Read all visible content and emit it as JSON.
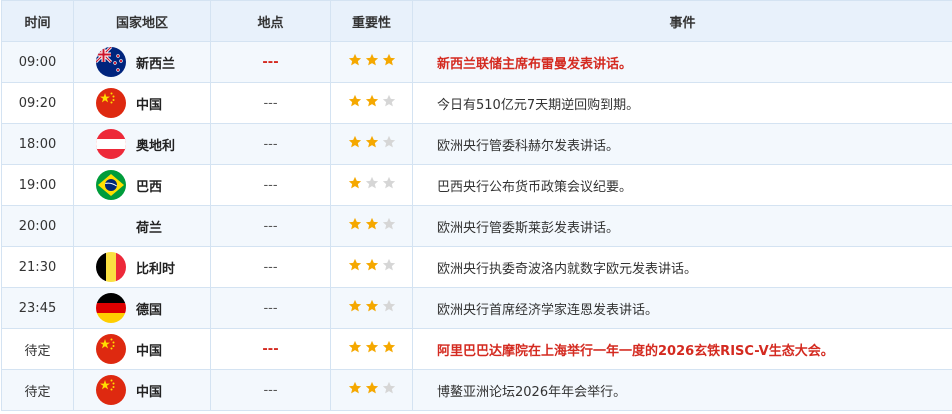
{
  "colors": {
    "header_bg": "#e8f1fb",
    "border": "#d4e3f2",
    "highlight": "#d42a20",
    "star_on": "#f5a800",
    "star_off": "#d6d6d6"
  },
  "header": {
    "time": "时间",
    "country": "国家地区",
    "location": "地点",
    "importance": "重要性",
    "event": "事件"
  },
  "rows": [
    {
      "time": "09:00",
      "flag": "new-zealand-flag-icon",
      "country": "新西兰",
      "location": "---",
      "stars": 3,
      "event": "新西兰联储主席布雷曼发表讲话。",
      "highlight": true
    },
    {
      "time": "09:20",
      "flag": "china-flag-icon",
      "country": "中国",
      "location": "---",
      "stars": 2,
      "event": "今日有510亿元7天期逆回购到期。",
      "highlight": false
    },
    {
      "time": "18:00",
      "flag": "austria-flag-icon",
      "country": "奥地利",
      "location": "---",
      "stars": 2,
      "event": "欧洲央行管委科赫尔发表讲话。",
      "highlight": false
    },
    {
      "time": "19:00",
      "flag": "brazil-flag-icon",
      "country": "巴西",
      "location": "---",
      "stars": 1,
      "event": "巴西央行公布货币政策会议纪要。",
      "highlight": false
    },
    {
      "time": "20:00",
      "flag": "",
      "country": "荷兰",
      "location": "---",
      "stars": 2,
      "event": "欧洲央行管委斯莱彭发表讲话。",
      "highlight": false
    },
    {
      "time": "21:30",
      "flag": "belgium-flag-icon",
      "country": "比利时",
      "location": "---",
      "stars": 2,
      "event": "欧洲央行执委奇波洛内就数字欧元发表讲话。",
      "highlight": false
    },
    {
      "time": "23:45",
      "flag": "germany-flag-icon",
      "country": "德国",
      "location": "---",
      "stars": 2,
      "event": "欧洲央行首席经济学家连恩发表讲话。",
      "highlight": false
    },
    {
      "time": "待定",
      "flag": "china-flag-icon",
      "country": "中国",
      "location": "---",
      "stars": 3,
      "event": "阿里巴巴达摩院在上海举行一年一度的2026玄铁RISC-V生态大会。",
      "highlight": true
    },
    {
      "time": "待定",
      "flag": "china-flag-icon",
      "country": "中国",
      "location": "---",
      "stars": 2,
      "event": "博鳌亚洲论坛2026年年会举行。",
      "highlight": false
    }
  ]
}
